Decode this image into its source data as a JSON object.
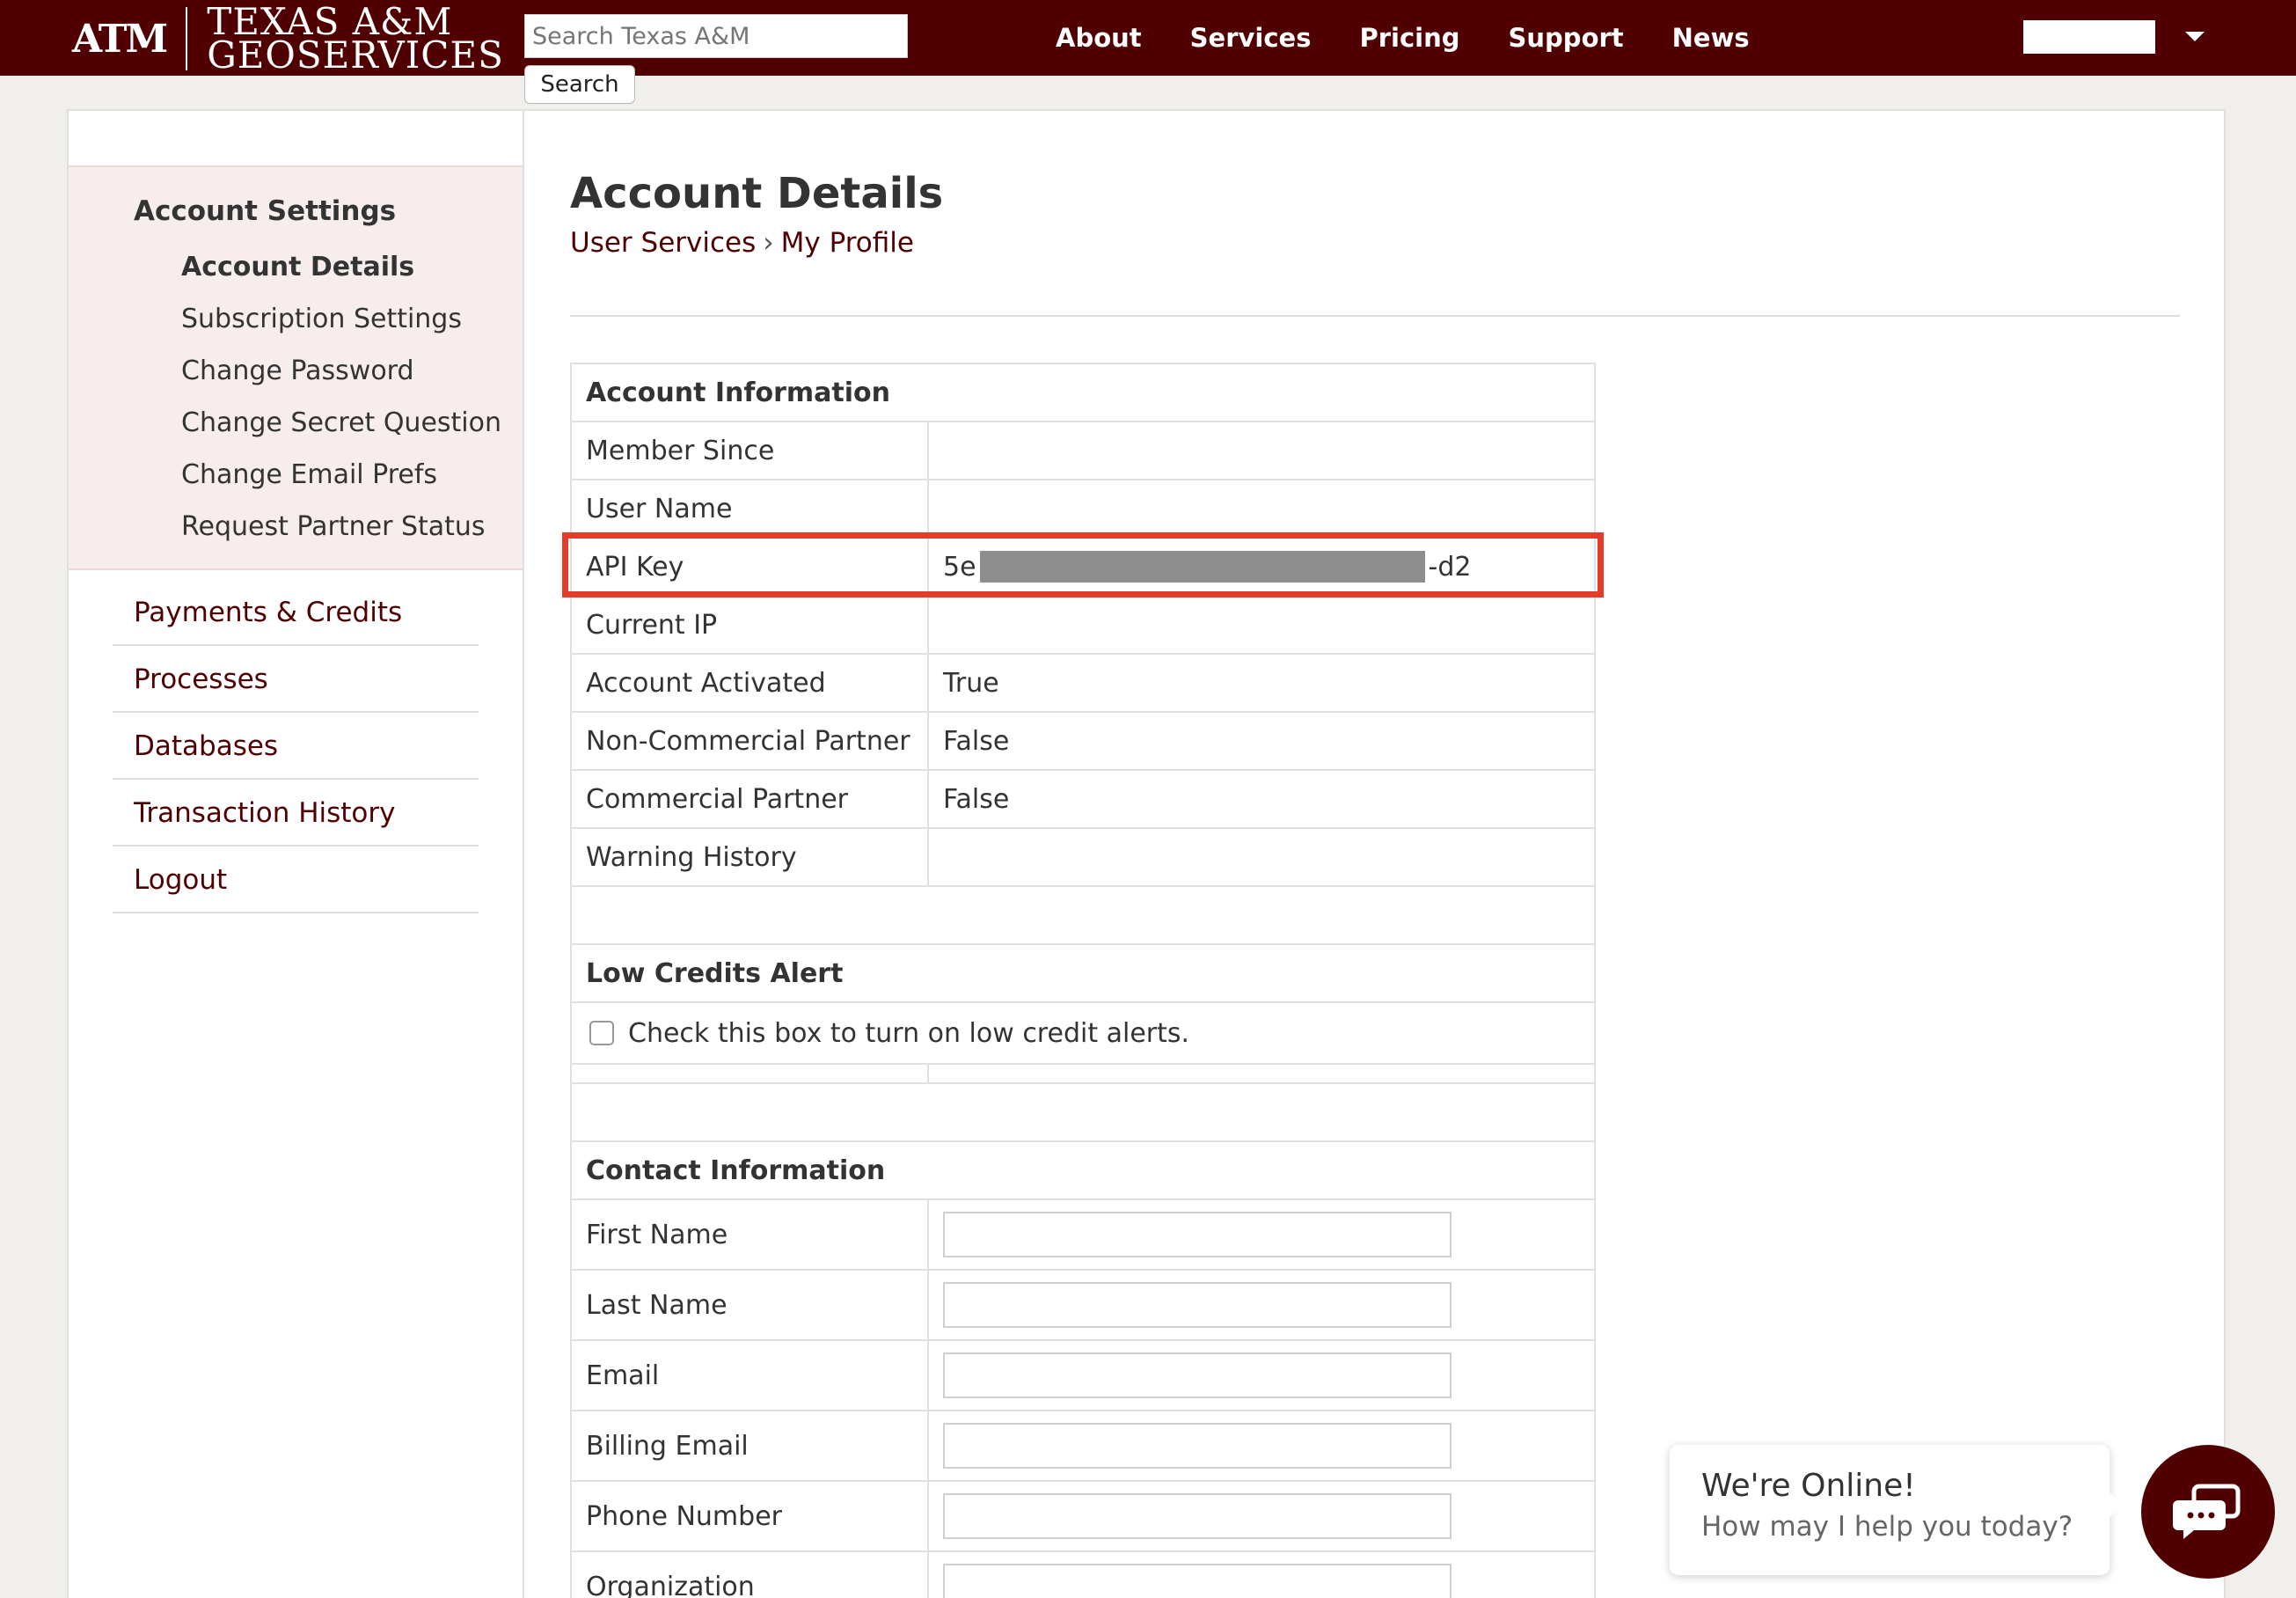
{
  "header": {
    "logo_mark": "ATM",
    "logo_line1": "TEXAS A&M",
    "logo_line2": "GEOSERVICES",
    "search_placeholder": "Search Texas A&M",
    "search_button": "Search",
    "nav": [
      "About",
      "Services",
      "Pricing",
      "Support",
      "News"
    ]
  },
  "sidebar": {
    "heading": "Account Settings",
    "subitems": [
      "Account Details",
      "Subscription Settings",
      "Change Password",
      "Change Secret Question",
      "Change Email Prefs",
      "Request Partner Status"
    ],
    "links": [
      "Payments & Credits",
      "Processes",
      "Databases",
      "Transaction History",
      "Logout"
    ]
  },
  "main": {
    "title": "Account Details",
    "breadcrumb": [
      "User Services",
      "My Profile"
    ],
    "breadcrumb_sep": "›",
    "account_info": {
      "heading": "Account Information",
      "rows": [
        {
          "label": "Member Since",
          "value": ""
        },
        {
          "label": "User Name",
          "value": ""
        },
        {
          "label": "API Key",
          "value_prefix": "5e",
          "value_suffix": "-d2"
        },
        {
          "label": "Current IP",
          "value": ""
        },
        {
          "label": "Account Activated",
          "value": "True"
        },
        {
          "label": "Non-Commercial Partner",
          "value": "False"
        },
        {
          "label": "Commercial Partner",
          "value": "False"
        },
        {
          "label": "Warning History",
          "value": ""
        }
      ]
    },
    "low_credits": {
      "heading": "Low Credits Alert",
      "checkbox_label": "Check this box to turn on low credit alerts."
    },
    "contact": {
      "heading": "Contact Information",
      "fields": [
        "First Name",
        "Last Name",
        "Email",
        "Billing Email",
        "Phone Number",
        "Organization"
      ]
    }
  },
  "chat": {
    "title": "We're Online!",
    "subtitle": "How may I help you today?"
  },
  "colors": {
    "brand": "#500000",
    "highlight": "#e53c2a"
  }
}
